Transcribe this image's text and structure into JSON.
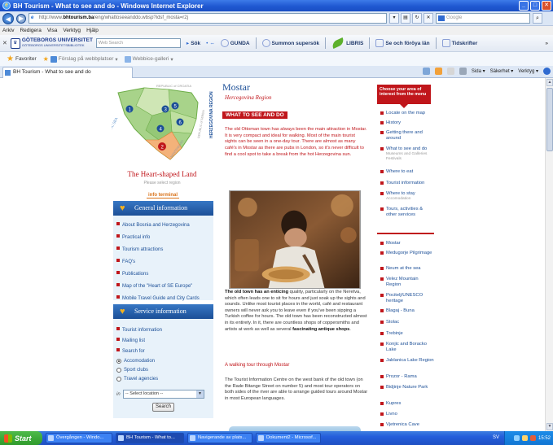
{
  "window": {
    "title": "BH Tourism - What to see and do - Windows Internet Explorer",
    "url_prefix": "http://www.",
    "url_host": "bhtourism.ba",
    "url_path": "/eng/whattoseeanddo.wbsp?idsf_mosta=r2j",
    "search_engine": "Google"
  },
  "menu": [
    "Arkiv",
    "Redigera",
    "Visa",
    "Verktyg",
    "Hjälp"
  ],
  "toolbar": {
    "university_line1": "GÖTEBORGS UNIVERSITET",
    "university_line2": "GÖTEBORGS UNIVERSITETSBIBLIOTEK",
    "search_placeholder": "Web Search",
    "search_btn": "Sök",
    "items": [
      "GUNDA",
      "Summon supersök",
      "LIBRIS",
      "Se och föröya län",
      "Tidskrifter"
    ]
  },
  "favorites": {
    "label": "Favoriter",
    "links": [
      "Förslag på webbplatser",
      "Webbice-galleri"
    ]
  },
  "tab": {
    "title": "BH Tourism - What to see and do"
  },
  "commands": [
    "Sida",
    "Säkerhet",
    "Verktyg"
  ],
  "left": {
    "map_country_label": "REPUBLIC of CROATIA",
    "map_sea_label": "ADRIATIC SEA",
    "map_montenegro_label": "MONTENEGRO",
    "map_serbia_label": "REPUBLIC of SERBIA",
    "map_numbers": [
      "1",
      "2",
      "3",
      "4",
      "5",
      "6"
    ],
    "heart_title": "The Heart-shaped Land",
    "heart_sub": "Please select region",
    "info_terminal": "info terminal",
    "general_header": "General information",
    "general_links": [
      "About Bosnia and Herzegovina",
      "Practical info",
      "Tourism attractions",
      "FAQ's",
      "Publications",
      "Map of the \"Heart of SE Europe\"",
      "Mobile Travel Guide and City Cards"
    ],
    "service_header": "Service information",
    "service_links": [
      "Tourist information",
      "Mailing list",
      "Search for"
    ],
    "radios": [
      "Accomodation",
      "Sport clubs",
      "Travel agencies"
    ],
    "in_label": "in",
    "location_select": "-- Select location --",
    "search_button": "Search"
  },
  "center": {
    "vertical_label": "HERZEGOVINA REGION",
    "title": "Mostar",
    "region_script": "Hercegovina Region",
    "badge": "WHAT TO SEE AND DO",
    "intro": "The old Ottoman town has always been the main attraction in Mostar. It is very compact and ideal for walking. Most of the main tourist sights can be seen in a one-day tour. There are almost as many café's in Mostar as there are pubs in London, so it's never difficult to find a cool spot to take a break from the hot Herzegovina sun.",
    "body_lead": "The old town has an enticing",
    "body_rest": " quality, particularly on the Neretva, which often leads one to sit for hours and just soak up the sights and sounds. Unlike most tourist places in the world, café and restaurant owners will never ask you to leave even if you've been sipping a Turkish coffee for hours. The old town has been reconstructed almost in its entirety. In it, there are countless shops of coppersmiths and artists at work as well as several ",
    "body_bold2": "fascinating antique shops",
    "body_end": ".",
    "walk_link": "A walking tour through Mostar",
    "body2": "The Tourist Information Centre on the west bank of the old town (on the Rade Bitange Street on number 5) and most tour operators on both sides of the river are able to arrange guided tours around Mostar in most European languages."
  },
  "right": {
    "choose_box": "Choose your area of interest from the menu",
    "links": [
      {
        "t": "Locate on the map",
        "s": ""
      },
      {
        "t": "History",
        "s": ""
      },
      {
        "t": "Getting there and around",
        "s": ""
      },
      {
        "t": "What to see and do",
        "s": "Museums and Galleries Festivals"
      },
      {
        "t": "Where to eat",
        "s": ""
      },
      {
        "t": "Tourist information",
        "s": ""
      },
      {
        "t": "Where to stay",
        "s": "Accomodation"
      },
      {
        "t": "Tours, activities & other services",
        "s": ""
      }
    ],
    "places": [
      "Mostar",
      "Medugorje Pilgrimage",
      "Neum at the sea",
      "Velez Mountain Region",
      "Pocitelj/UNESCO heritage",
      "Blagaj - Buna",
      "Stolac",
      "Trebinje",
      "Konjic and Boracko Lake",
      "Jablanica Lake Region",
      "Prozor - Rama",
      "Bidjinje Nature Park",
      "Kupres",
      "Livno",
      "Vjetrenica Cave"
    ]
  },
  "taskbar": {
    "start": "Start",
    "tasks": [
      "Övergången - Windo...",
      "BH Tourism - What to...",
      "Navigerande av plats...",
      "Dokument2 - Microsof..."
    ],
    "lang": "SV",
    "clock": "15:52"
  },
  "colors": {
    "brand_red": "#c0161b",
    "brand_blue": "#1c4f97",
    "xp_blue": "#245edb"
  }
}
